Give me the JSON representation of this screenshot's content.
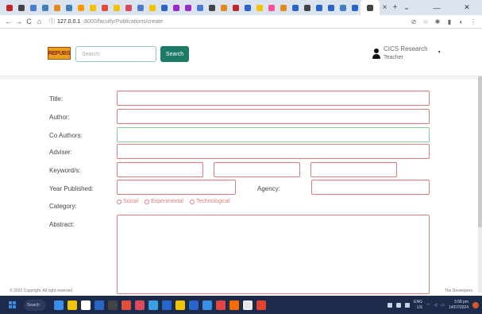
{
  "browser": {
    "tab_colors": [
      "#c1272d",
      "#444444",
      "#4a7bd0",
      "#3f7fbf",
      "#e08a1e",
      "#3f7fbf",
      "#ff9800",
      "#f2c400",
      "#e44c3c",
      "#f2c400",
      "#d94a5f",
      "#4a7bd0",
      "#f2c400",
      "#2a66c9",
      "#9b2ac9",
      "#9b2ac9",
      "#4a7bd0",
      "#444444",
      "#e08a1e",
      "#c1272d",
      "#2a66c9",
      "#f2c400",
      "#ff4d9a",
      "#e08a1e",
      "#2a66c9",
      "#444444",
      "#2a66c9",
      "#2a66c9",
      "#3f7fbf",
      "#2a66c9",
      "#444444"
    ],
    "url_host": "127.0.0.1",
    "url_path": ":8000/faculty/Publications/create",
    "tab_close": "×",
    "new_tab": "+",
    "window_controls": [
      "⌄",
      "—",
      "✕"
    ],
    "nav": {
      "back": "←",
      "forward": "→",
      "reload": "C",
      "home": "⌂",
      "info": "ⓘ"
    },
    "toolbar_icons": [
      "⊘",
      "☆",
      "✱",
      "▮",
      "◐",
      "⋮"
    ]
  },
  "header": {
    "logo_text": "REPUBS",
    "search_placeholder": "Search",
    "search_button": "Search",
    "user_name": "CICS Research",
    "user_role": "Teacher",
    "caret": "▾"
  },
  "form": {
    "title_label": "Title:",
    "author_label": "Author:",
    "coauthors_label": "Co Authors:",
    "adviser_label": "Adviser:",
    "keywords_label": "Keyword/s:",
    "year_label": "Year Published:",
    "agency_label": "Agency:",
    "category_label": "Category:",
    "categories": [
      "Social",
      "Experimental",
      "Technological"
    ],
    "abstract_label": "Abstract:"
  },
  "footer": {
    "copyright": "© 2022 Copyright. All right reserved",
    "developer": "The Developers"
  },
  "taskbar": {
    "search_label": "Search",
    "app_colors": [
      "#3a8ee6",
      "#f2c400",
      "#ffffff",
      "#2a66c9",
      "#444444",
      "#e44c3c",
      "#d94a5f",
      "#3aa0e6",
      "#2a66c9",
      "#f2c400",
      "#2a66c9",
      "#3a8ee6",
      "#e04444",
      "#ff6a00",
      "#e8e8e8",
      "#e0442c"
    ],
    "lang_line1": "ENG",
    "lang_line2": "US",
    "time": "3:58 pm",
    "date": "14/07/2024"
  },
  "colors": {
    "accent": "#1f7a66",
    "field_error": "#e07a7a",
    "field_valid": "#8ccb9a"
  }
}
